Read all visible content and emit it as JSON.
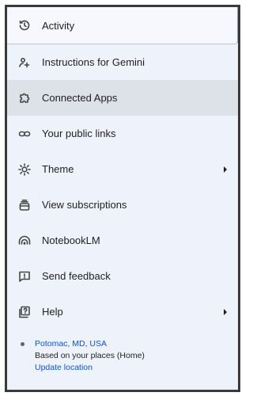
{
  "menu": {
    "items": [
      {
        "label": "Activity",
        "icon": "history-icon"
      },
      {
        "label": "Instructions for Gemini",
        "icon": "person-instructions-icon"
      },
      {
        "label": "Connected Apps",
        "icon": "puzzle-icon"
      },
      {
        "label": "Your public links",
        "icon": "link-icon"
      },
      {
        "label": "Theme",
        "icon": "sun-theme-icon",
        "submenu": true
      },
      {
        "label": "View subscriptions",
        "icon": "subscriptions-icon"
      },
      {
        "label": "NotebookLM",
        "icon": "notebooklm-icon"
      },
      {
        "label": "Send feedback",
        "icon": "feedback-icon"
      },
      {
        "label": "Help",
        "icon": "help-icon",
        "submenu": true
      }
    ]
  },
  "location": {
    "place": "Potomac, MD, USA",
    "source": "Based on your places (Home)",
    "update_link": "Update location"
  },
  "colors": {
    "panel_bg": "#eef2fa",
    "hover_bg": "#dde1e8",
    "link": "#0b57d0",
    "text": "#1f1f1f"
  }
}
